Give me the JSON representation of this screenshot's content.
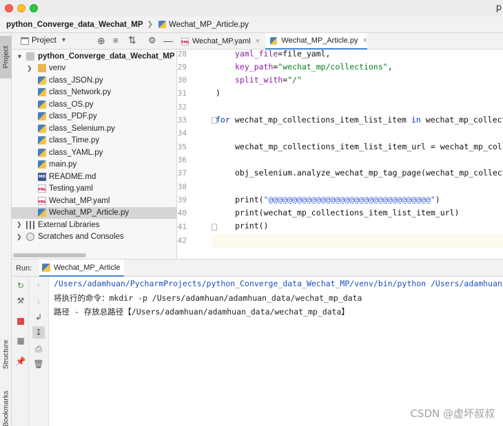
{
  "window": {
    "title_fragment": "p"
  },
  "breadcrumb": {
    "project": "python_Converge_data_Wechat_MP",
    "file": "Wechat_MP_Article.py"
  },
  "left_strip": {
    "project_tab": "Project",
    "structure_tab": "Structure",
    "bookmarks_tab": "Bookmarks"
  },
  "project_panel": {
    "view_selector": "Project",
    "root": "python_Converge_data_Wechat_MP",
    "items": [
      {
        "label": "venv",
        "icon": "folder-icon"
      },
      {
        "label": "class_JSON.py",
        "icon": "python-file-icon"
      },
      {
        "label": "class_Network.py",
        "icon": "python-file-icon"
      },
      {
        "label": "class_OS.py",
        "icon": "python-file-icon"
      },
      {
        "label": "class_PDF.py",
        "icon": "python-file-icon"
      },
      {
        "label": "class_Selenium.py",
        "icon": "python-file-icon"
      },
      {
        "label": "class_Time.py",
        "icon": "python-file-icon"
      },
      {
        "label": "class_YAML.py",
        "icon": "python-file-icon"
      },
      {
        "label": "main.py",
        "icon": "python-file-icon"
      },
      {
        "label": "README.md",
        "icon": "markdown-file-icon"
      },
      {
        "label": "Testing.yaml",
        "icon": "yaml-file-icon"
      },
      {
        "label": "Wechat_MP.yaml",
        "icon": "yaml-file-icon"
      },
      {
        "label": "Wechat_MP_Article.py",
        "icon": "python-file-icon",
        "selected": true
      },
      {
        "label": "External Libraries",
        "icon": "library-icon"
      },
      {
        "label": "Scratches and Consoles",
        "icon": "scratches-icon"
      }
    ]
  },
  "editor": {
    "tabs": [
      {
        "label": "Wechat_MP.yaml",
        "close": "×"
      },
      {
        "label": "Wechat_MP_Article.py",
        "close": "×",
        "active": true
      }
    ],
    "line_numbers": [
      "28",
      "29",
      "30",
      "31",
      "32",
      "33",
      "34",
      "35",
      "36",
      "37",
      "38",
      "39",
      "40",
      "41",
      "42"
    ],
    "lines": {
      "l28_param": "yaml_file",
      "l28_rest": "=file_yaml,",
      "l29_param": "key_path",
      "l29_eq": "=",
      "l29_str": "\"wechat_mp/collections\"",
      "l29_rest": ",",
      "l30_param": "split_with",
      "l30_eq": "=",
      "l30_str": "\"/\"",
      "l31": ")",
      "l33_kw1": "for",
      "l33_mid": " wechat_mp_collections_item_list_item ",
      "l33_kw2": "in",
      "l33_rest": " wechat_mp_collect",
      "l35": "wechat_mp_collections_item_list_item_url = wechat_mp_coll",
      "l37": "obj_selenium.analyze_wechat_mp_tag_page(wechat_mp_collect",
      "l39_fn": "print(",
      "l39_str": "\"@@@@@@@@@@@@@@@@@@@@@@@@@@@@@@@@@@\"",
      "l39_end": ")",
      "l40": "print(wechat_mp_collections_item_list_item_url)",
      "l41": "print()"
    }
  },
  "run": {
    "label": "Run:",
    "tab": "Wechat_MP_Article",
    "output": [
      "/Users/adamhuan/PycharmProjects/python_Converge_data_Wechat_MP/venv/bin/python /Users/adamhuan/",
      "将执行的命令：mkdir -p /Users/adamhuan/adamhuan_data/wechat_mp_data",
      "路径 - 存放总路径【/Users/adamhuan/adamhuan_data/wechat_mp_data】"
    ]
  },
  "watermark": "CSDN @虚坏叔叔"
}
